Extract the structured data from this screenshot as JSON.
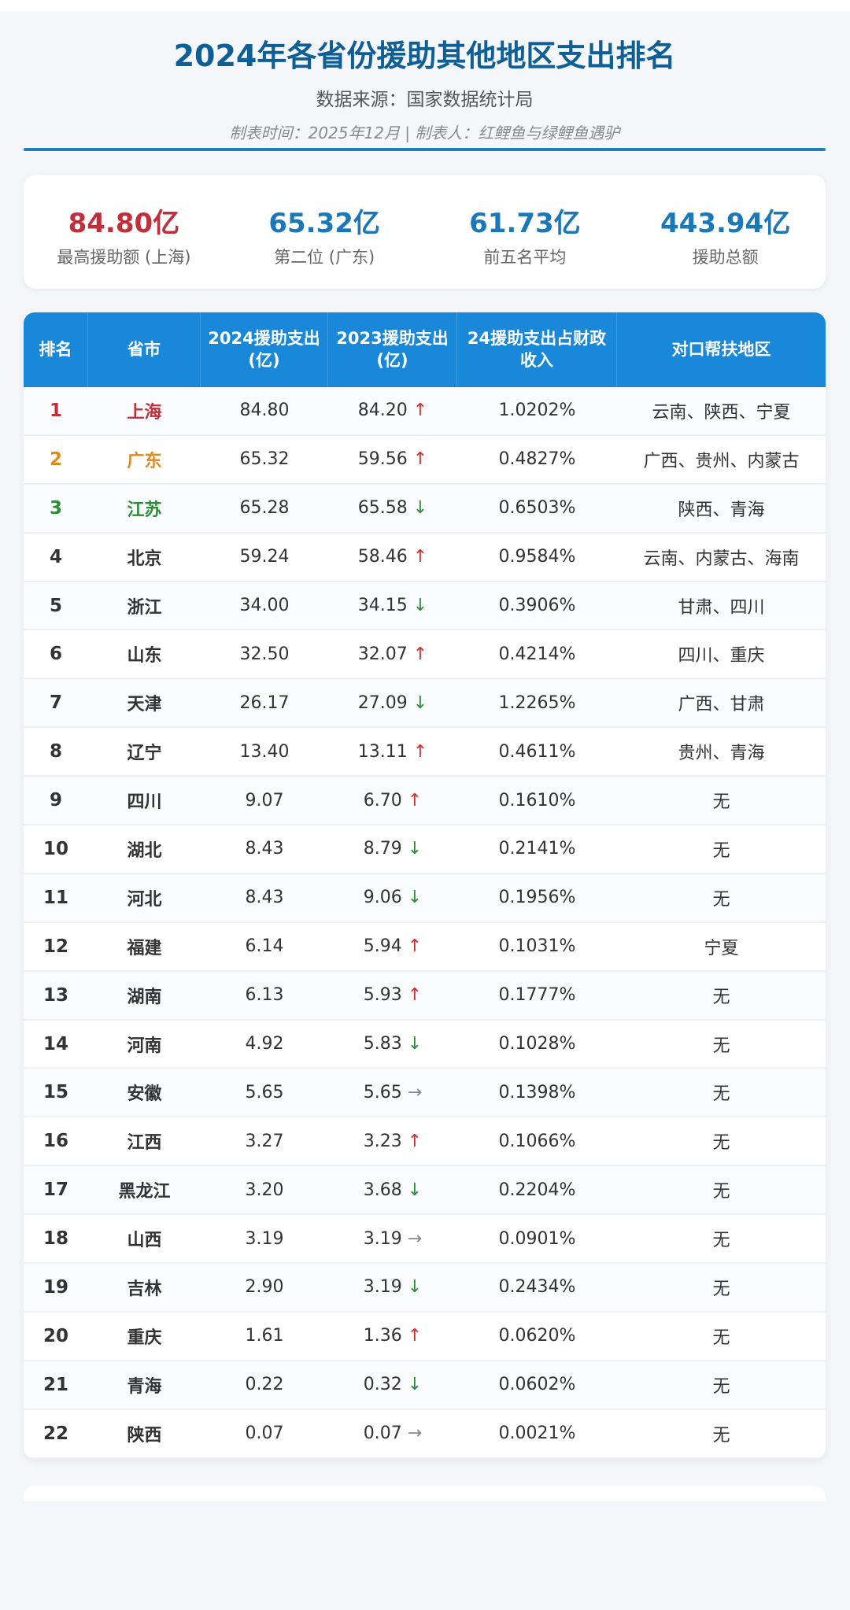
{
  "header": {
    "title": "2024年各省份援助其他地区支出排名",
    "source": "数据来源：国家数据统计局",
    "meta": "制表时间：2025年12月 | 制表人：红鲤鱼与绿鲤鱼遇驴"
  },
  "stats": [
    {
      "value": "84.80亿",
      "label": "最高援助额 (上海)"
    },
    {
      "value": "65.32亿",
      "label": "第二位 (广东)"
    },
    {
      "value": "61.73亿",
      "label": "前五名平均"
    },
    {
      "value": "443.94亿",
      "label": "援助总额"
    }
  ],
  "columns": [
    "排名",
    "省市",
    "2024援助支出(亿)",
    "2023援助支出(亿)",
    "24援助支出占财政收入",
    "对口帮扶地区"
  ],
  "colors": {
    "up": "#d0302e",
    "down": "#2e8b3a",
    "rank1": "#c0303a",
    "rank2": "#e08a1e",
    "rank3": "#2e8b3a",
    "header": "#1a88d8"
  },
  "rows": [
    {
      "rank": "1",
      "prov": "上海",
      "y24": "84.80",
      "y23": "84.20",
      "trend": "up",
      "ratio": "1.0202%",
      "regions": "云南、陕西、宁夏"
    },
    {
      "rank": "2",
      "prov": "广东",
      "y24": "65.32",
      "y23": "59.56",
      "trend": "up",
      "ratio": "0.4827%",
      "regions": "广西、贵州、内蒙古"
    },
    {
      "rank": "3",
      "prov": "江苏",
      "y24": "65.28",
      "y23": "65.58",
      "trend": "down",
      "ratio": "0.6503%",
      "regions": "陕西、青海"
    },
    {
      "rank": "4",
      "prov": "北京",
      "y24": "59.24",
      "y23": "58.46",
      "trend": "up",
      "ratio": "0.9584%",
      "regions": "云南、内蒙古、海南"
    },
    {
      "rank": "5",
      "prov": "浙江",
      "y24": "34.00",
      "y23": "34.15",
      "trend": "down",
      "ratio": "0.3906%",
      "regions": "甘肃、四川"
    },
    {
      "rank": "6",
      "prov": "山东",
      "y24": "32.50",
      "y23": "32.07",
      "trend": "up",
      "ratio": "0.4214%",
      "regions": "四川、重庆"
    },
    {
      "rank": "7",
      "prov": "天津",
      "y24": "26.17",
      "y23": "27.09",
      "trend": "down",
      "ratio": "1.2265%",
      "regions": "广西、甘肃"
    },
    {
      "rank": "8",
      "prov": "辽宁",
      "y24": "13.40",
      "y23": "13.11",
      "trend": "up",
      "ratio": "0.4611%",
      "regions": "贵州、青海"
    },
    {
      "rank": "9",
      "prov": "四川",
      "y24": "9.07",
      "y23": "6.70",
      "trend": "up",
      "ratio": "0.1610%",
      "regions": "无"
    },
    {
      "rank": "10",
      "prov": "湖北",
      "y24": "8.43",
      "y23": "8.79",
      "trend": "down",
      "ratio": "0.2141%",
      "regions": "无"
    },
    {
      "rank": "11",
      "prov": "河北",
      "y24": "8.43",
      "y23": "9.06",
      "trend": "down",
      "ratio": "0.1956%",
      "regions": "无"
    },
    {
      "rank": "12",
      "prov": "福建",
      "y24": "6.14",
      "y23": "5.94",
      "trend": "up",
      "ratio": "0.1031%",
      "regions": "宁夏"
    },
    {
      "rank": "13",
      "prov": "湖南",
      "y24": "6.13",
      "y23": "5.93",
      "trend": "up",
      "ratio": "0.1777%",
      "regions": "无"
    },
    {
      "rank": "14",
      "prov": "河南",
      "y24": "4.92",
      "y23": "5.83",
      "trend": "down",
      "ratio": "0.1028%",
      "regions": "无"
    },
    {
      "rank": "15",
      "prov": "安徽",
      "y24": "5.65",
      "y23": "5.65",
      "trend": "flat",
      "ratio": "0.1398%",
      "regions": "无"
    },
    {
      "rank": "16",
      "prov": "江西",
      "y24": "3.27",
      "y23": "3.23",
      "trend": "up",
      "ratio": "0.1066%",
      "regions": "无"
    },
    {
      "rank": "17",
      "prov": "黑龙江",
      "y24": "3.20",
      "y23": "3.68",
      "trend": "down",
      "ratio": "0.2204%",
      "regions": "无"
    },
    {
      "rank": "18",
      "prov": "山西",
      "y24": "3.19",
      "y23": "3.19",
      "trend": "flat",
      "ratio": "0.0901%",
      "regions": "无"
    },
    {
      "rank": "19",
      "prov": "吉林",
      "y24": "2.90",
      "y23": "3.19",
      "trend": "down",
      "ratio": "0.2434%",
      "regions": "无"
    },
    {
      "rank": "20",
      "prov": "重庆",
      "y24": "1.61",
      "y23": "1.36",
      "trend": "up",
      "ratio": "0.0620%",
      "regions": "无"
    },
    {
      "rank": "21",
      "prov": "青海",
      "y24": "0.22",
      "y23": "0.32",
      "trend": "down",
      "ratio": "0.0602%",
      "regions": "无"
    },
    {
      "rank": "22",
      "prov": "陕西",
      "y24": "0.07",
      "y23": "0.07",
      "trend": "flat",
      "ratio": "0.0021%",
      "regions": "无"
    }
  ]
}
